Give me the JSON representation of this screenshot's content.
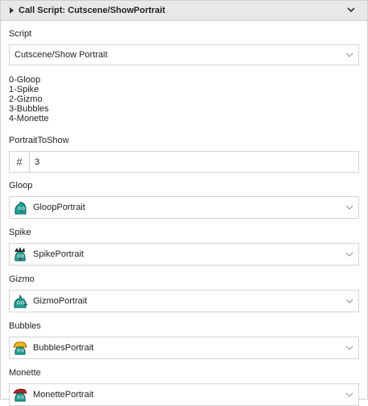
{
  "header": {
    "title": "Call Script: Cutscene/ShowPortrait"
  },
  "script": {
    "label": "Script",
    "value": "Cutscene/Show Portrait"
  },
  "notes": [
    "0-Gloop",
    "1-Spike",
    "2-Gizmo",
    "3-Bubbles",
    "4-Monette"
  ],
  "portrait_to_show": {
    "label": "PortraitToShow",
    "value": "3",
    "hash": "#"
  },
  "characters": [
    {
      "label": "Gloop",
      "value": "GloopPortrait",
      "icon": "gloop-portrait-icon"
    },
    {
      "label": "Spike",
      "value": "SpikePortrait",
      "icon": "spike-portrait-icon"
    },
    {
      "label": "Gizmo",
      "value": "GizmoPortrait",
      "icon": "gizmo-portrait-icon"
    },
    {
      "label": "Bubbles",
      "value": "BubblesPortrait",
      "icon": "bubbles-portrait-icon"
    },
    {
      "label": "Monette",
      "value": "MonettePortrait",
      "icon": "monette-portrait-icon"
    }
  ],
  "colors": {
    "header_bg": "#e8e8e8",
    "border": "#d4d4d4",
    "teal": "#1fa59a"
  }
}
